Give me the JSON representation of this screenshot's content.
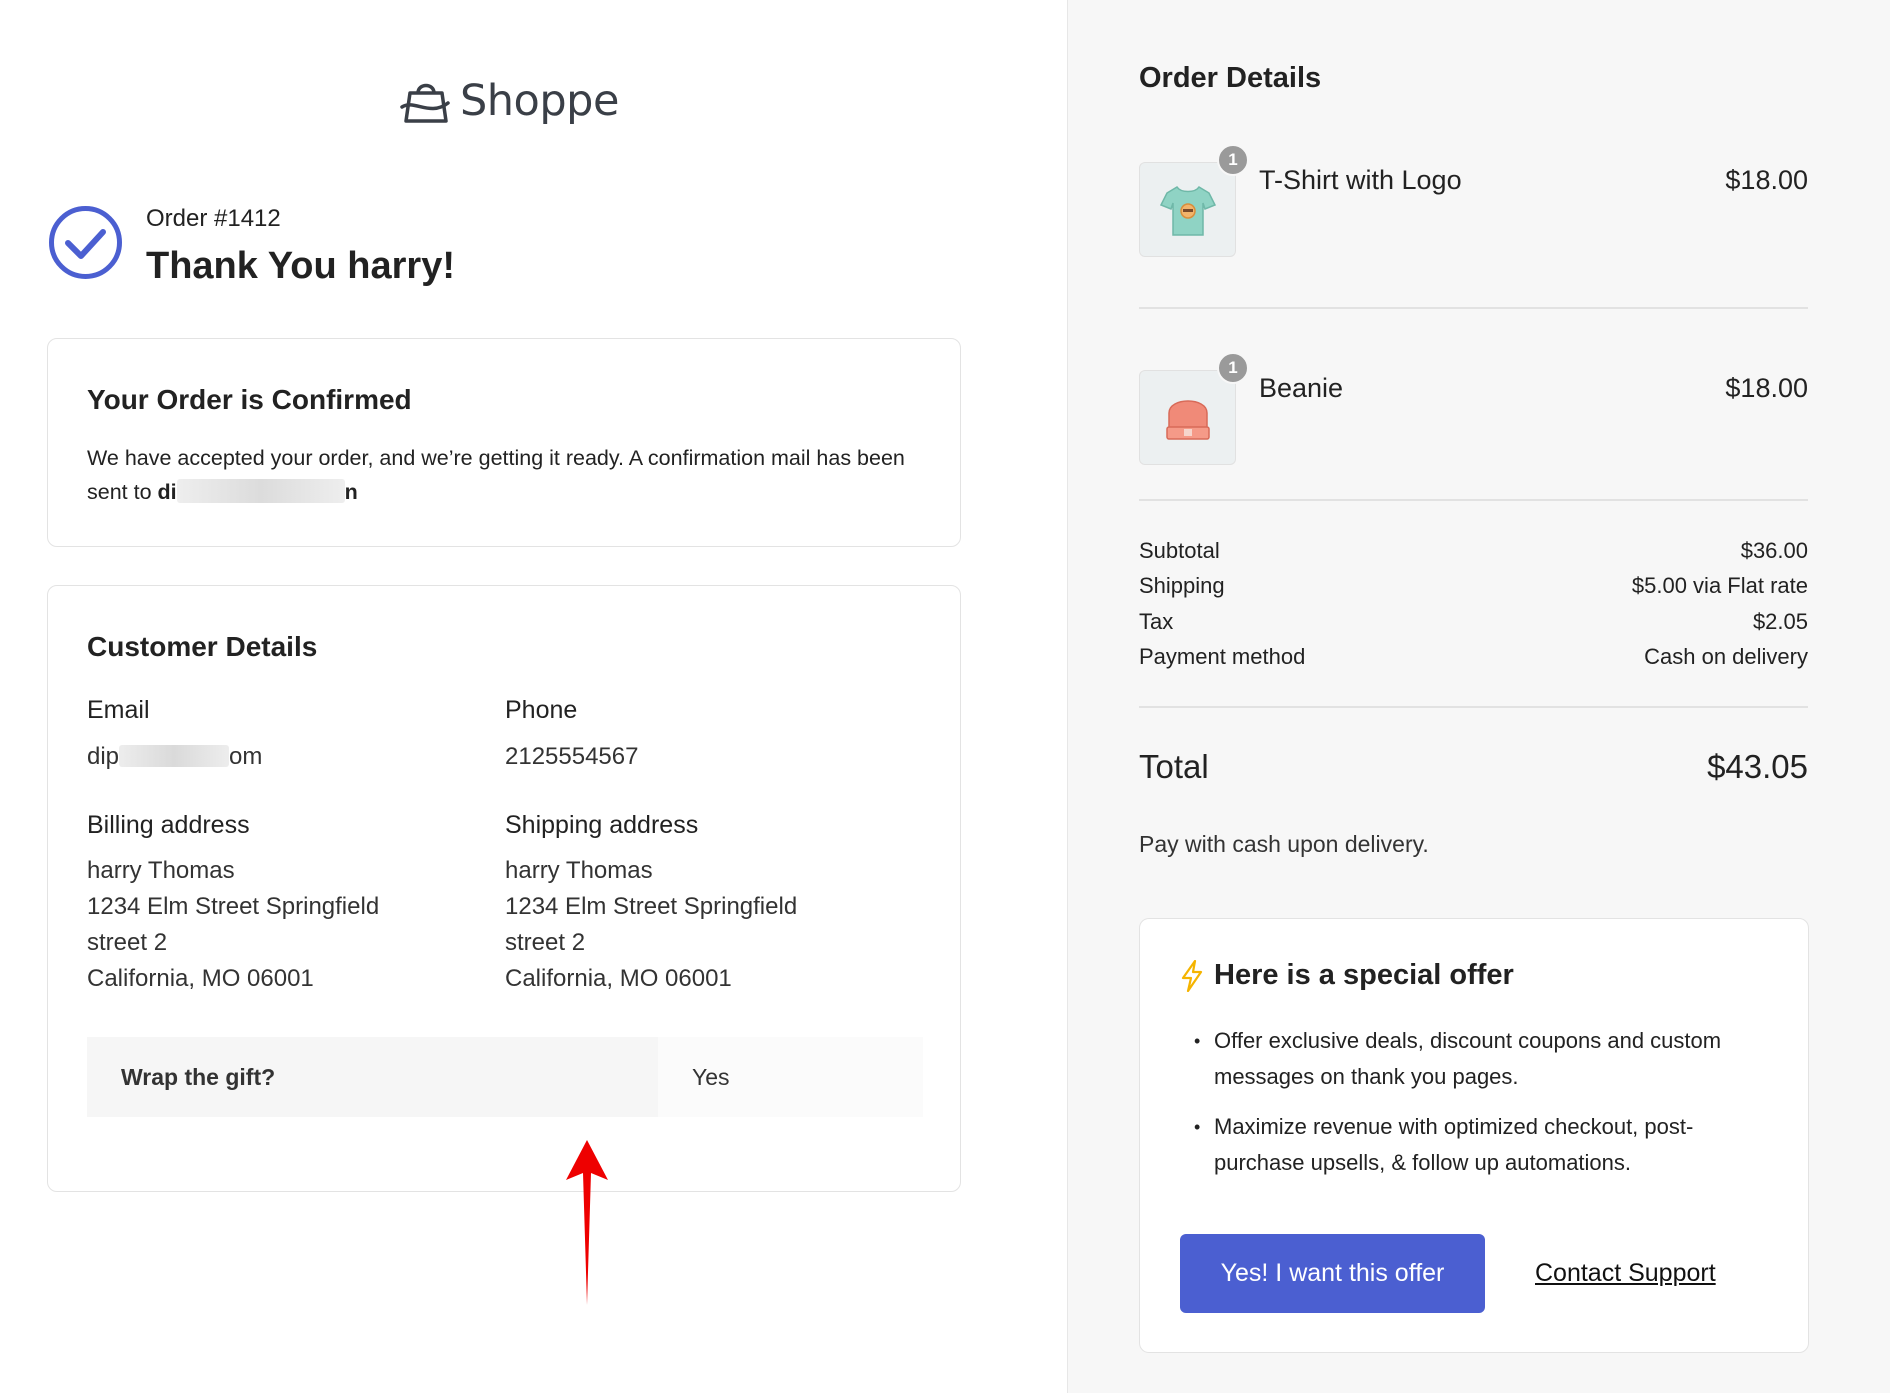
{
  "brand": {
    "name": "Shoppe"
  },
  "header": {
    "order_number": "Order #1412",
    "thank_you": "Thank You harry!"
  },
  "confirmation": {
    "title": "Your Order is Confirmed",
    "text": "We have accepted your order, and we’re getting it ready. A confirmation mail has been sent to ",
    "email_start": "di",
    "email_end": "n"
  },
  "customer": {
    "title": "Customer Details",
    "email_label": "Email",
    "email_start": "dip",
    "email_end": "om",
    "phone_label": "Phone",
    "phone_value": "2125554567",
    "billing_label": "Billing address",
    "billing": [
      "harry Thomas",
      "1234 Elm Street Springfield",
      "street 2",
      "California, MO 06001"
    ],
    "shipping_label": "Shipping address",
    "shipping": [
      "harry Thomas",
      "1234 Elm Street Springfield",
      "street 2",
      "California, MO 06001"
    ],
    "gift_question": "Wrap the gift?",
    "gift_answer": "Yes"
  },
  "order": {
    "title": "Order Details",
    "items": [
      {
        "name": "T-Shirt with Logo",
        "price": "$18.00",
        "qty": "1",
        "icon": "tshirt-icon"
      },
      {
        "name": "Beanie",
        "price": "$18.00",
        "qty": "1",
        "icon": "beanie-icon"
      }
    ],
    "summary": [
      {
        "label": "Subtotal",
        "value": "$36.00"
      },
      {
        "label": "Shipping",
        "value": "$5.00 via Flat rate"
      },
      {
        "label": "Tax",
        "value": "$2.05"
      },
      {
        "label": "Payment method",
        "value": "Cash on delivery"
      }
    ],
    "total_label": "Total",
    "total_value": "$43.05",
    "pay_note": "Pay with cash upon delivery."
  },
  "offer": {
    "title": "Here is a special offer",
    "bullets": [
      "Offer exclusive deals, discount coupons and custom messages on thank you pages.",
      "Maximize revenue with optimized checkout, post-purchase upsells, & follow up automations."
    ],
    "button_label": "Yes! I want this offer",
    "support_label": "Contact Support"
  },
  "colors": {
    "accent": "#4b5fd1",
    "check": "#4b5fd1",
    "arrow": "#ee0000",
    "bolt": "#f5b400"
  }
}
